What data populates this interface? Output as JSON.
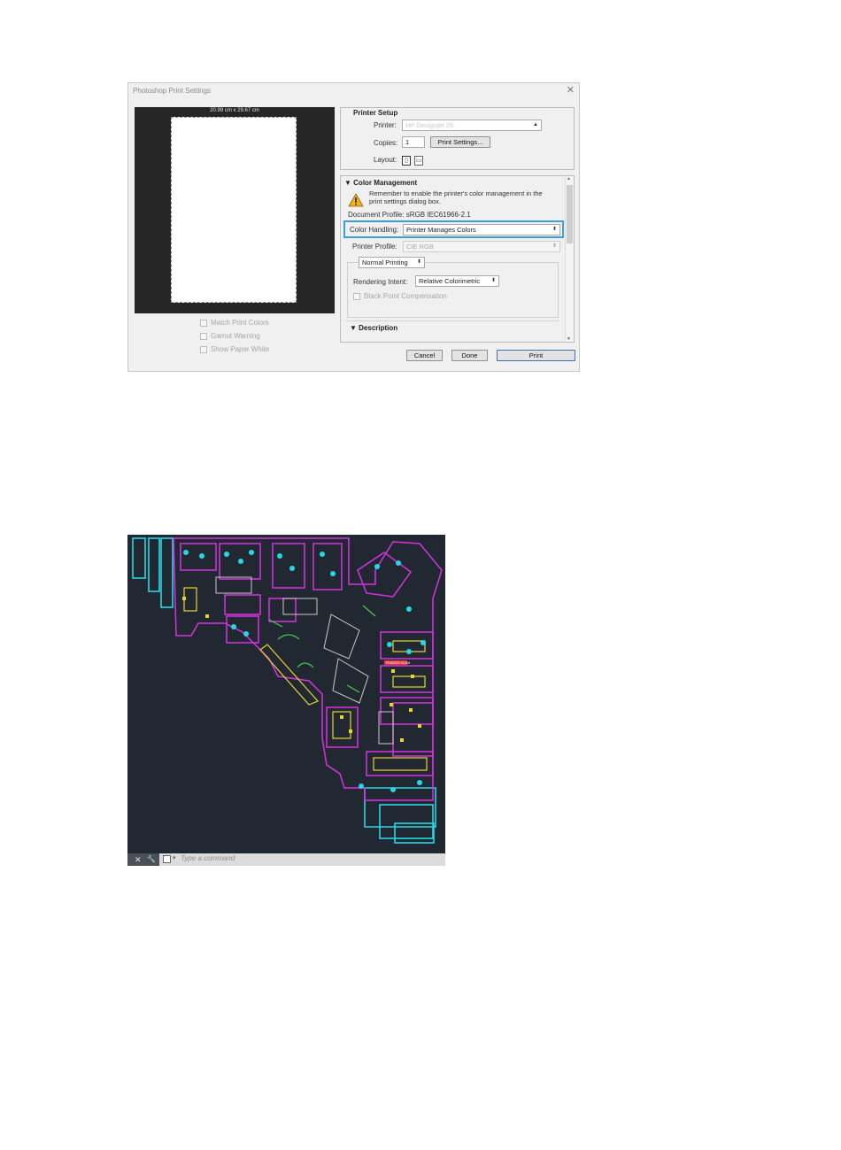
{
  "dialog": {
    "title": "Photoshop Print Settings",
    "close_glyph": "✕",
    "preview": {
      "paper_size": "20.99 cm x 29.67 cm"
    },
    "left_checkboxes": [
      "Match Print Colors",
      "Gamut Warning",
      "Show Paper White"
    ],
    "printer_setup": {
      "title": "Printer Setup",
      "printer_label": "Printer:",
      "printer_value": "HP Designjet Z6",
      "copies_label": "Copies:",
      "copies_value": "1",
      "print_settings_button": "Print Settings...",
      "layout_label": "Layout:",
      "layout_icons": [
        "portrait-layout-icon",
        "landscape-layout-icon"
      ]
    },
    "color_management": {
      "title": "Color Management",
      "warning_text": "Remember to enable the printer's color management in the print settings dialog box.",
      "document_profile": "Document Profile: sRGB IEC61966-2.1",
      "color_handling_label": "Color Handling:",
      "color_handling_value": "Printer Manages Colors",
      "printer_profile_label": "Printer Profile:",
      "printer_profile_value": "CIE RGB",
      "proof_mode": "Normal Printing",
      "rendering_intent_label": "Rendering Intent:",
      "rendering_intent_value": "Relative Colorimetric",
      "black_point_label": "Black Point Compensation",
      "description_title": "Description"
    },
    "buttons": {
      "cancel": "Cancel",
      "done": "Done",
      "print": "Print"
    },
    "colors": {
      "highlight": "#3aa1d8",
      "preview_bg": "#262626"
    }
  },
  "cad": {
    "command_placeholder": "Type a command",
    "status_controls": [
      "✕",
      "🔧"
    ],
    "label_room": "PRINTER ROOM",
    "colors": {
      "bg": "#222832",
      "magenta": "#d633e0",
      "cyan": "#27d7e6",
      "yellow": "#e6d533",
      "green": "#40d04a",
      "white": "#e6e6e6",
      "red": "#e03a3a"
    }
  }
}
